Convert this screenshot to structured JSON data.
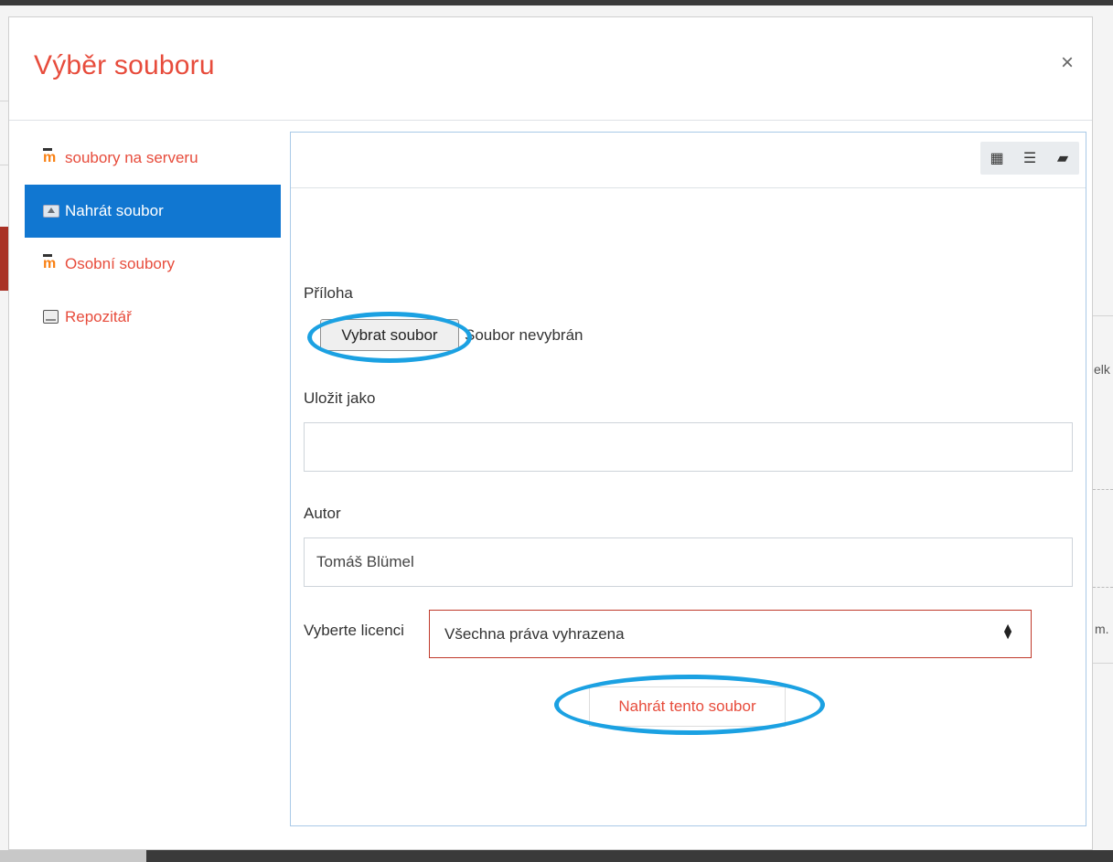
{
  "dialog": {
    "title": "Výběr souboru",
    "close_symbol": "×"
  },
  "nav": {
    "items": [
      {
        "label": "soubory na serveru",
        "icon": "moodle-icon",
        "active": false
      },
      {
        "label": "Nahrát soubor",
        "icon": "upload-icon",
        "active": true
      },
      {
        "label": "Osobní soubory",
        "icon": "moodle-icon",
        "active": false
      },
      {
        "label": "Repozitář",
        "icon": "repository-icon",
        "active": false
      }
    ]
  },
  "toolbar": {
    "view_icons": [
      "grid-view-icon",
      "list-view-icon",
      "folder-view-icon"
    ],
    "glyphs": [
      "▦",
      "☰",
      "▰"
    ]
  },
  "form": {
    "attachment_label": "Příloha",
    "choose_file_button": "Vybrat soubor",
    "file_status": "Soubor nevybrán",
    "save_as_label": "Uložit jako",
    "save_as_value": "",
    "author_label": "Autor",
    "author_value": "Tomáš Blümel",
    "license_label": "Vyberte licenci",
    "license_value": "Všechna práva vyhrazena",
    "upload_button": "Nahrát tento soubor"
  },
  "background": {
    "right_fragments": [
      "elk",
      "m."
    ]
  },
  "colors": {
    "accent": "#e74c3c",
    "active_nav": "#1177d1",
    "annotation": "#1ba1e2"
  }
}
